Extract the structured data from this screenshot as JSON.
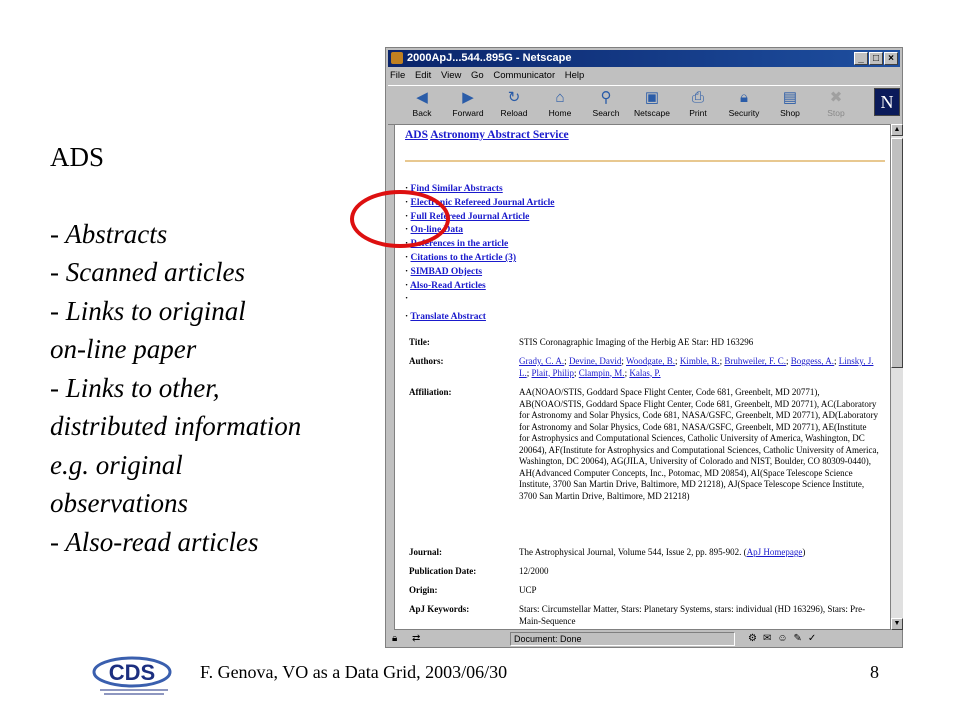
{
  "slide": {
    "heading": "ADS",
    "bullets": [
      "- Abstracts",
      "- Scanned articles",
      "- Links to original",
      " on-line paper",
      "- Links to other,",
      " distributed information",
      " e.g. original",
      " observations",
      "- Also-read articles"
    ],
    "footer": "F. Genova, VO as a Data Grid, 2003/06/30",
    "page_number": "8",
    "logo_text": "CDS"
  },
  "browser": {
    "title": "2000ApJ...544..895G - Netscape",
    "menu": [
      "File",
      "Edit",
      "View",
      "Go",
      "Communicator",
      "Help"
    ],
    "toolbar": [
      "Back",
      "Forward",
      "Reload",
      "Home",
      "Search",
      "Netscape",
      "Print",
      "Security",
      "Shop",
      "Stop"
    ],
    "status": "Document: Done",
    "brand_letter": "N"
  },
  "page": {
    "ads_link": "ADS",
    "service_link": "Astronomy Abstract Service",
    "links": [
      "Find Similar Abstracts",
      "Electronic Refereed Journal Article",
      "Full Refereed Journal Article",
      "On-line Data",
      "References in the article",
      "Citations to the Article (3)",
      "SIMBAD Objects",
      "Also-Read Articles",
      "",
      "Translate Abstract"
    ],
    "bullet": "·",
    "title_label": "Title:",
    "title_value": "STIS Coronagraphic Imaging of the Herbig AE Star: HD 163296",
    "authors_label": "Authors:",
    "authors": [
      "Grady, C. A.",
      "Devine, David",
      "Woodgate, B.",
      "Kimble, R.",
      "Bruhweiler, F. C.",
      "Boggess, A.",
      "Linsky, J. L.",
      "Plait, Philip",
      "Clampin, M.",
      "Kalas, P."
    ],
    "affiliation_label": "Affiliation:",
    "affiliation_value": "AA(NOAO/STIS, Goddard Space Flight Center, Code 681, Greenbelt, MD 20771), AB(NOAO/STIS, Goddard Space Flight Center, Code 681, Greenbelt, MD 20771), AC(Laboratory for Astronomy and Solar Physics, Code 681, NASA/GSFC, Greenbelt, MD 20771), AD(Laboratory for Astronomy and Solar Physics, Code 681, NASA/GSFC, Greenbelt, MD 20771), AE(Institute for Astrophysics and Computational Sciences, Catholic University of America, Washington, DC 20064), AF(Institute for Astrophysics and Computational Sciences, Catholic University of America, Washington, DC 20064), AG(JILA, University of Colorado and NIST, Boulder, CO 80309-0440), AH(Advanced Computer Concepts, Inc., Potomac, MD 20854), AI(Space Telescope Science Institute, 3700 San Martin Drive, Baltimore, MD 21218), AJ(Space Telescope Science Institute, 3700 San Martin Drive, Baltimore, MD 21218)",
    "journal_label": "Journal:",
    "journal_value": "The Astrophysical Journal, Volume 544, Issue 2, pp. 895-902. (",
    "journal_link": "ApJ Homepage",
    "journal_close": ")",
    "pubdate_label": "Publication Date:",
    "pubdate_value": "12/2000",
    "origin_label": "Origin:",
    "origin_value": "UCP",
    "keywords_label": "ApJ Keywords:",
    "keywords_value": "Stars: Circumstellar Matter, Stars: Planetary Systems, stars: individual (HD 163296), Stars: Pre-Main-Sequence"
  },
  "colors": {
    "annotation": "#dd1010",
    "link": "#1a1acc",
    "titlebar": "#0a246a"
  }
}
